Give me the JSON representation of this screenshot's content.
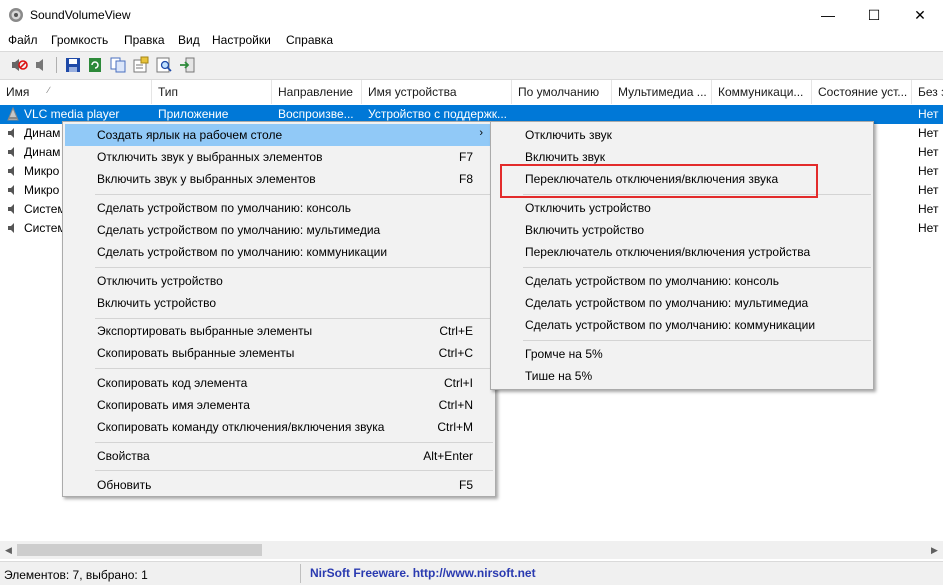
{
  "window": {
    "title": "SoundVolumeView",
    "minimize": "—",
    "maximize": "☐",
    "close": "✕"
  },
  "menubar": [
    "Файл",
    "Громкость",
    "Правка",
    "Вид",
    "Настройки",
    "Справка"
  ],
  "toolbar_icons": [
    "mute-speaker-icon",
    "speaker-icon",
    "save-icon",
    "refresh-icon",
    "copy-icon",
    "properties-icon",
    "find-icon",
    "exit-icon"
  ],
  "columns": [
    "Имя",
    "Тип",
    "Направление",
    "Имя устройства",
    "По умолчанию",
    "Мультимедиа ...",
    "Коммуникаци...",
    "Состояние уст...",
    "Без з"
  ],
  "rows": [
    {
      "name": "VLC media player",
      "type": "Приложение",
      "direction": "Воспроизве...",
      "device": "Устройство с поддержк...",
      "last": "Нет"
    },
    {
      "name": "Динам",
      "last": "Нет"
    },
    {
      "name": "Динам",
      "last": "Нет"
    },
    {
      "name": "Микро",
      "last": "Нет"
    },
    {
      "name": "Микро",
      "last": "Нет"
    },
    {
      "name": "Систем",
      "last": "Нет"
    },
    {
      "name": "Систем",
      "last": "Нет"
    }
  ],
  "context_menu": {
    "items": [
      {
        "label": "Создать ярлык на рабочем столе",
        "shortcut": "",
        "submenu": true
      },
      {
        "label": "Отключить звук у выбранных элементов",
        "shortcut": "F7"
      },
      {
        "label": "Включить звук у выбранных элементов",
        "shortcut": "F8"
      },
      {
        "label": "Сделать устройством по умолчанию: консоль",
        "shortcut": ""
      },
      {
        "label": "Сделать устройством по умолчанию: мультимедиа",
        "shortcut": ""
      },
      {
        "label": "Сделать устройством по умолчанию: коммуникации",
        "shortcut": ""
      },
      {
        "label": "Отключить устройство",
        "shortcut": ""
      },
      {
        "label": "Включить устройство",
        "shortcut": ""
      },
      {
        "label": "Экспортировать выбранные элементы",
        "shortcut": "Ctrl+E"
      },
      {
        "label": "Скопировать выбранные элементы",
        "shortcut": "Ctrl+C"
      },
      {
        "label": "Скопировать код элемента",
        "shortcut": "Ctrl+I"
      },
      {
        "label": "Скопировать имя элемента",
        "shortcut": "Ctrl+N"
      },
      {
        "label": "Скопировать команду отключения/включения звука",
        "shortcut": "Ctrl+M"
      },
      {
        "label": "Свойства",
        "shortcut": "Alt+Enter"
      },
      {
        "label": "Обновить",
        "shortcut": "F5"
      }
    ],
    "submenu_arrow": "›"
  },
  "submenu": {
    "items": [
      "Отключить звук",
      "Включить звук",
      "Переключатель отключения/включения звука",
      "Отключить устройство",
      "Включить устройство",
      "Переключатель отключения/включения устройства",
      "Сделать устройством по умолчанию: консоль",
      "Сделать устройством по умолчанию: мультимедиа",
      "Сделать устройством по умолчанию: коммуникации",
      "Громче на 5%",
      "Тише на 5%"
    ]
  },
  "statusbar": {
    "count": "Элементов: 7, выбрано: 1",
    "link": "NirSoft Freeware.  http://www.nirsoft.net"
  },
  "colors": {
    "selection": "#0078d7",
    "menu_hover": "#91c9f7",
    "highlight": "#e32b2b",
    "link": "#2a3ab0"
  }
}
